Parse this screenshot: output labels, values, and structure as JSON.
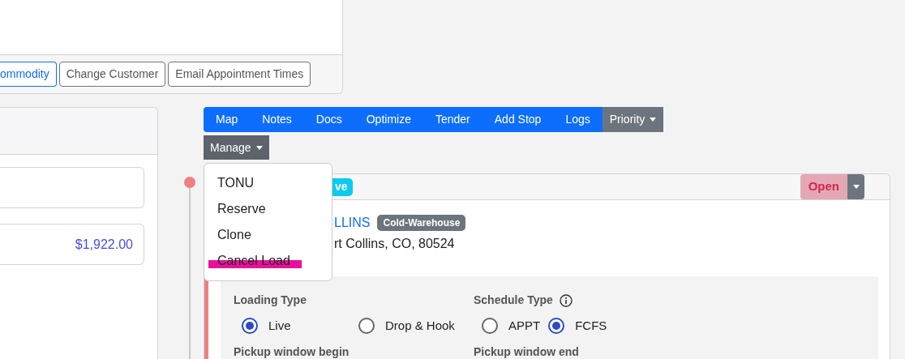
{
  "top_card": {
    "buttons": [
      {
        "label": "ommodity",
        "kind": "primary"
      },
      {
        "label": "Change Customer",
        "kind": "secondary"
      },
      {
        "label": "Email Appointment Times",
        "kind": "secondary"
      }
    ]
  },
  "left_card": {
    "fields": [
      {
        "kind": "input"
      },
      {
        "kind": "input",
        "value": "$1,922.00"
      }
    ]
  },
  "nav": {
    "items": [
      {
        "label": "Map",
        "kind": "link"
      },
      {
        "label": "Notes",
        "kind": "link"
      },
      {
        "label": "Docs",
        "kind": "link"
      },
      {
        "label": "Optimize",
        "kind": "link"
      },
      {
        "label": "Tender",
        "kind": "link"
      },
      {
        "label": "Add Stop",
        "kind": "link"
      },
      {
        "label": "Logs",
        "kind": "link"
      },
      {
        "label": "Priority",
        "kind": "dropdown"
      }
    ],
    "manage": {
      "label": "Manage",
      "expanded": true,
      "menu": [
        {
          "label": "TONU",
          "highlighted": false
        },
        {
          "label": "Reserve",
          "highlighted": false
        },
        {
          "label": "Clone",
          "highlighted": false
        },
        {
          "label": "Cancel Load",
          "highlighted": true
        }
      ]
    }
  },
  "stop": {
    "badge": "ve",
    "status": "Open",
    "name": "LLINS",
    "tag": "Cold-Warehouse",
    "address": "rt Collins, CO, 80524",
    "loading_type": {
      "label": "Loading Type",
      "options": [
        {
          "label": "Live",
          "selected": true
        },
        {
          "label": "Drop & Hook",
          "selected": false
        }
      ]
    },
    "schedule_type": {
      "label": "Schedule Type",
      "options": [
        {
          "label": "APPT",
          "selected": false
        },
        {
          "label": "FCFS",
          "selected": true
        }
      ]
    },
    "window_begin": "Pickup window begin",
    "window_end": "Pickup window end"
  }
}
